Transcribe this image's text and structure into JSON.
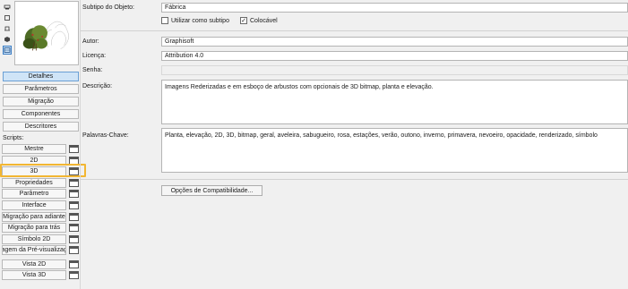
{
  "nav": {
    "details": "Detalhes",
    "parameters": "Parâmetros",
    "migration": "Migração",
    "components": "Componentes",
    "descriptors": "Descritores"
  },
  "scripts": {
    "label": "Scripts:",
    "items": [
      {
        "label": "Mestre"
      },
      {
        "label": "2D"
      },
      {
        "label": "3D"
      },
      {
        "label": "Propriedades"
      },
      {
        "label": "Parâmetro"
      },
      {
        "label": "Interface"
      },
      {
        "label": "Migração para adiante"
      },
      {
        "label": "Migração para trás"
      },
      {
        "label": "Símbolo 2D"
      },
      {
        "label": "Imagem da Pré-visualização"
      },
      {
        "label": "Vista 2D"
      },
      {
        "label": "Vista 3D"
      }
    ]
  },
  "details": {
    "subtype_label": "Subtipo do Objeto:",
    "subtype_value": "Fábrica",
    "use_as_subtype_label": "Utilizar como subtipo",
    "use_as_subtype_checked": false,
    "placeable_label": "Colocável",
    "placeable_checked": true,
    "author_label": "Autor:",
    "author_value": "Graphisoft",
    "license_label": "Licença:",
    "license_value": "Attribution 4.0",
    "password_label": "Senha:",
    "password_value": "",
    "description_label": "Descrição:",
    "description_value": "Imagens Rederizadas e em esboço de arbustos com opcionais de 3D bitmap, planta e elevação.",
    "keywords_label": "Palavras-Chave:",
    "keywords_value": "Planta, elevação, 2D, 3D, bitmap, geral, aveleira, sabugueiro, rosa, estações, verão, outono, inverno, primavera, nevoeiro, opacidade, renderizado, símbolo",
    "compat_button": "Opções de Compatibilidade..."
  },
  "colors": {
    "active_nav": "#cfe4f7",
    "highlight": "#f2b632"
  }
}
